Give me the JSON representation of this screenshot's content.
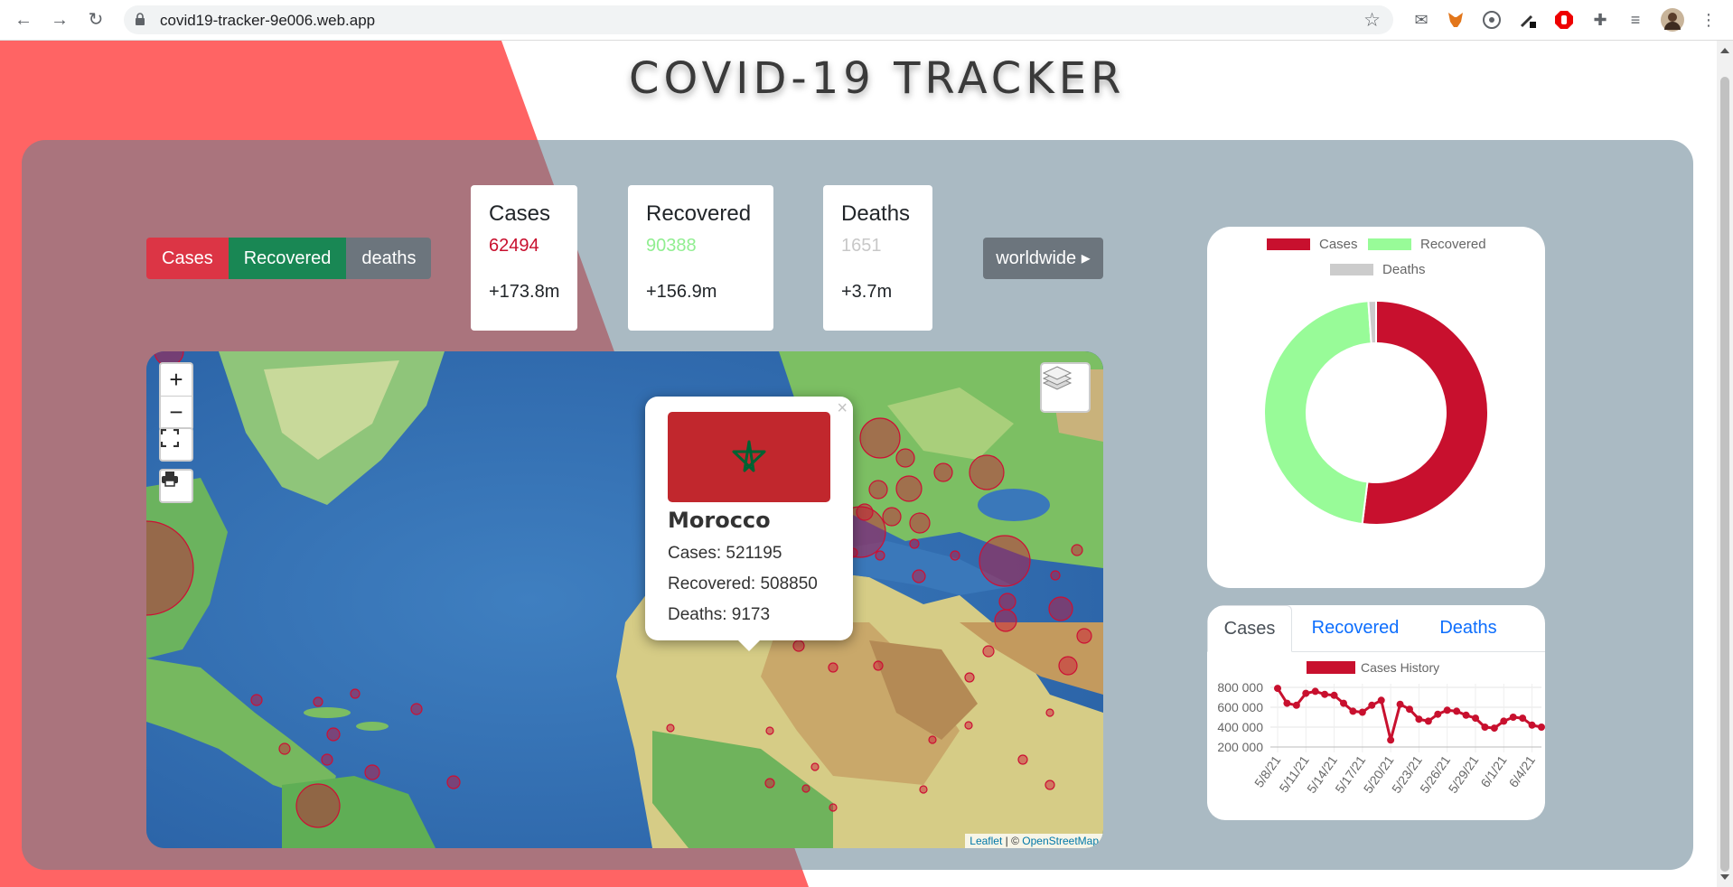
{
  "browser": {
    "url": "covid19-tracker-9e006.web.app"
  },
  "page": {
    "title": "COVID-19 TRACKER"
  },
  "filter_buttons": [
    {
      "label": "Cases",
      "color": "#dc3545"
    },
    {
      "label": "Recovered",
      "color": "#198754"
    },
    {
      "label": "deaths",
      "color": "#6c757d"
    }
  ],
  "stats": [
    {
      "title": "Cases",
      "value": "62494",
      "total": "+173.8m",
      "color": "#c8102e"
    },
    {
      "title": "Recovered",
      "value": "90388",
      "total": "+156.9m",
      "color": "#90ee90"
    },
    {
      "title": "Deaths",
      "value": "1651",
      "total": "+3.7m",
      "color": "#c8c8c8"
    }
  ],
  "worldwide_button": "worldwide",
  "map": {
    "zoom_in": "+",
    "zoom_out": "−",
    "attribution_leaflet": "Leaflet",
    "attribution_sep": "| ©",
    "attribution_osm": "OpenStreetMap"
  },
  "popup": {
    "close": "×",
    "country": "Morocco",
    "cases": "Cases: 521195",
    "recovered": "Recovered: 508850",
    "deaths": "Deaths: 9173"
  },
  "doughnut": {
    "legend": [
      {
        "label": "Cases",
        "color": "#c8102e"
      },
      {
        "label": "Recovered",
        "color": "#98fb98"
      },
      {
        "label": "Deaths",
        "color": "#cccccc"
      }
    ]
  },
  "history": {
    "tabs": [
      "Cases",
      "Recovered",
      "Deaths"
    ],
    "active_tab": "Cases"
  },
  "chart_data": [
    {
      "type": "pie",
      "labels": [
        "Cases",
        "Recovered",
        "Deaths"
      ],
      "values": [
        173.8,
        156.9,
        3.7
      ],
      "colors": [
        "#c8102e",
        "#98fb98",
        "#cccccc"
      ]
    },
    {
      "type": "line",
      "title": "",
      "series": [
        {
          "name": "Cases History",
          "values": [
            790000,
            640000,
            620000,
            740000,
            760000,
            730000,
            720000,
            640000,
            560000,
            550000,
            620000,
            670000,
            270000,
            630000,
            580000,
            480000,
            460000,
            530000,
            570000,
            560000,
            520000,
            490000,
            400000,
            390000,
            460000,
            500000,
            490000,
            420000,
            400000
          ]
        }
      ],
      "x_ticks": [
        "5/8/21",
        "5/11/21",
        "5/14/21",
        "5/17/21",
        "5/20/21",
        "5/23/21",
        "5/26/21",
        "5/29/21",
        "6/1/21",
        "6/4/21"
      ],
      "y_ticks": [
        "800 000",
        "600 000",
        "400 000",
        "200 000"
      ],
      "ylim": [
        200000,
        800000
      ],
      "color": "#c8102e"
    }
  ]
}
